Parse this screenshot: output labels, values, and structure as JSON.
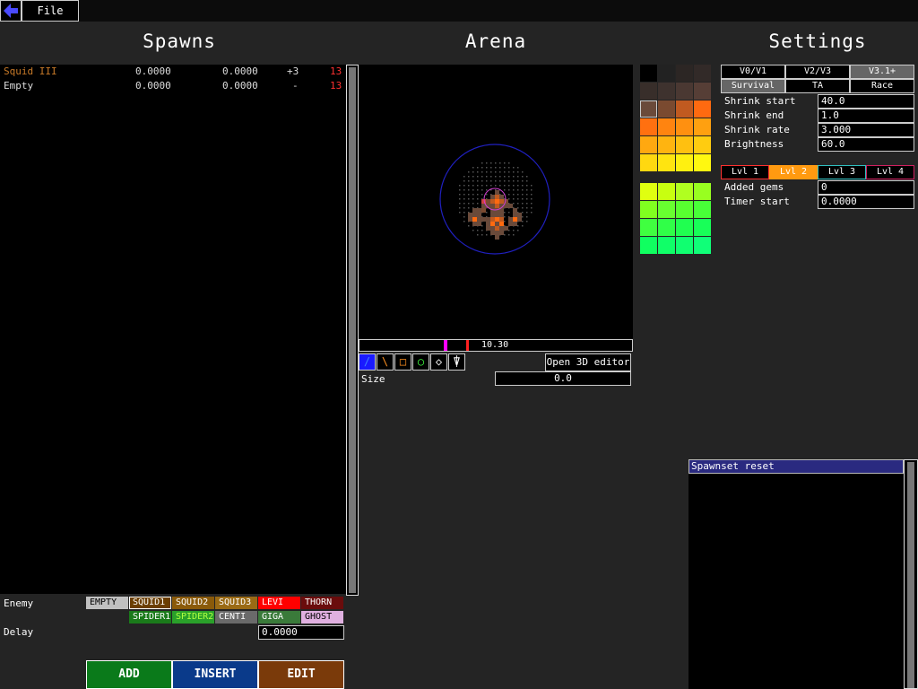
{
  "topbar": {
    "file_label": "File"
  },
  "spawns": {
    "title": "Spawns",
    "rows": [
      {
        "name": "Squid III",
        "delay": "0.0000",
        "seconds": "0.0000",
        "gems": "+3",
        "total": "13",
        "color": "#c87a28"
      },
      {
        "name": "Empty",
        "delay": "0.0000",
        "seconds": "0.0000",
        "gems": "-",
        "total": "13",
        "color": "#dddddd"
      }
    ],
    "enemy_label": "Enemy",
    "delay_label": "Delay",
    "delay_value": "0.0000",
    "enemies": [
      {
        "label": "EMPTY",
        "bg": "#c0c0c0",
        "fg": "#000000"
      },
      {
        "label": "SQUID1",
        "bg": "#6b3e00",
        "fg": "#ffffff"
      },
      {
        "label": "SQUID2",
        "bg": "#8a5a0a",
        "fg": "#ffffff"
      },
      {
        "label": "SQUID3",
        "bg": "#9a6a14",
        "fg": "#ffffff"
      },
      {
        "label": "LEVI",
        "bg": "#ff0000",
        "fg": "#ffffff"
      },
      {
        "label": "THORN",
        "bg": "#6a0c0c",
        "fg": "#ffffff"
      },
      {
        "label": "SPIDER1",
        "bg": "#1a7a1a",
        "fg": "#ffffff"
      },
      {
        "label": "SPIDER2",
        "bg": "#2aa02a",
        "fg": "#b0ff40"
      },
      {
        "label": "CENTI",
        "bg": "#6a6a6a",
        "fg": "#ffffff"
      },
      {
        "label": "GIGA",
        "bg": "#3a7a3a",
        "fg": "#ffffff"
      },
      {
        "label": "GHOST",
        "bg": "#e0b0e0",
        "fg": "#000000"
      }
    ],
    "buttons": {
      "add": "ADD",
      "insert": "INSERT",
      "edit": "EDIT"
    }
  },
  "arena": {
    "title": "Arena",
    "timeline_value": "10.30",
    "open_3d_label": "Open 3D editor",
    "size_label": "Size",
    "size_value": "0.0",
    "tools": [
      {
        "name": "pencil-tool-icon",
        "glyph": "/",
        "color": "#4080ff"
      },
      {
        "name": "line-tool-icon",
        "glyph": "\\",
        "color": "#ff9020"
      },
      {
        "name": "rectangle-tool-icon",
        "glyph": "□",
        "color": "#ff9020"
      },
      {
        "name": "ellipse-tool-icon",
        "glyph": "○",
        "color": "#40ff40"
      },
      {
        "name": "dagger-tool-icon",
        "glyph": "◇",
        "color": "#ffffff"
      },
      {
        "name": "bucket-tool-icon",
        "glyph": "⍒",
        "color": "#ffffff"
      }
    ]
  },
  "settings": {
    "title": "Settings",
    "versions": [
      "V0/V1",
      "V2/V3",
      "V3.1+"
    ],
    "modes": [
      "Survival",
      "TA",
      "Race"
    ],
    "fields": [
      {
        "label": "Shrink start",
        "value": "40.0"
      },
      {
        "label": "Shrink end",
        "value": "1.0"
      },
      {
        "label": "Shrink rate",
        "value": "3.000"
      },
      {
        "label": "Brightness",
        "value": "60.0"
      }
    ],
    "levels": [
      "Lvl 1",
      "Lvl 2",
      "Lvl 3",
      "Lvl 4"
    ],
    "level_fields": [
      {
        "label": "Added gems",
        "value": "0"
      },
      {
        "label": "Timer start",
        "value": "0.0000"
      }
    ]
  },
  "history": {
    "items": [
      "Spawnset reset"
    ]
  },
  "palette": {
    "rows": [
      [
        "#000000",
        "#222222",
        "#2c2624",
        "#322a28"
      ],
      [
        "#382e2a",
        "#3e322e",
        "#4a3832",
        "#563e36"
      ],
      [
        "#6a4a3a",
        "#7a4a30",
        "#c05a20",
        "#ff6a10"
      ],
      [
        "#ff7010",
        "#ff8410",
        "#ff9010",
        "#ffa010"
      ],
      [
        "#ffa810",
        "#ffb410",
        "#ffc010",
        "#ffcc10"
      ],
      [
        "#ffd810",
        "#ffe410",
        "#fff010",
        "#fff810"
      ],
      [
        "#e0ff10",
        "#c8ff10",
        "#b0ff20",
        "#98ff20"
      ],
      [
        "#80ff20",
        "#68ff30",
        "#58ff30",
        "#48ff38"
      ],
      [
        "#40ff40",
        "#30ff48",
        "#20ff50",
        "#18ff58"
      ],
      [
        "#10ff60",
        "#10ff68",
        "#10ff70",
        "#10ff78"
      ]
    ]
  }
}
